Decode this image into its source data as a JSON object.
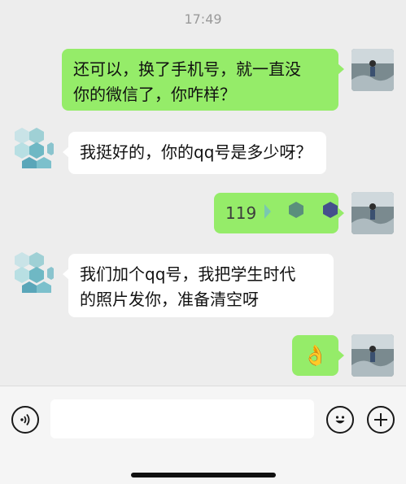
{
  "status": {
    "time": "17:49"
  },
  "colors": {
    "background": "#ededed",
    "sent_bubble": "#95ec69",
    "received_bubble": "#ffffff"
  },
  "messages": [
    {
      "direction": "sent",
      "text_lines": [
        "还可以，换了手机号，就一直没",
        "你的微信了，你咋样？"
      ]
    },
    {
      "direction": "received",
      "text_lines": [
        "我挺好的，你的qq号是多少呀？"
      ]
    },
    {
      "direction": "sent",
      "text_lines": [
        "119"
      ],
      "extra_icons": [
        "chevron-right-icon",
        "hexagon-icon",
        "hexagon-icon"
      ]
    },
    {
      "direction": "received",
      "text_lines": [
        "我们加个qq号，我把学生时代",
        "的照片发你，准备清空呀"
      ]
    },
    {
      "direction": "sent",
      "emoji": "👌"
    }
  ],
  "input_bar": {
    "voice_icon": "voice-icon",
    "emoji_icon": "emoji-icon",
    "add_icon": "add-icon",
    "text": ""
  }
}
